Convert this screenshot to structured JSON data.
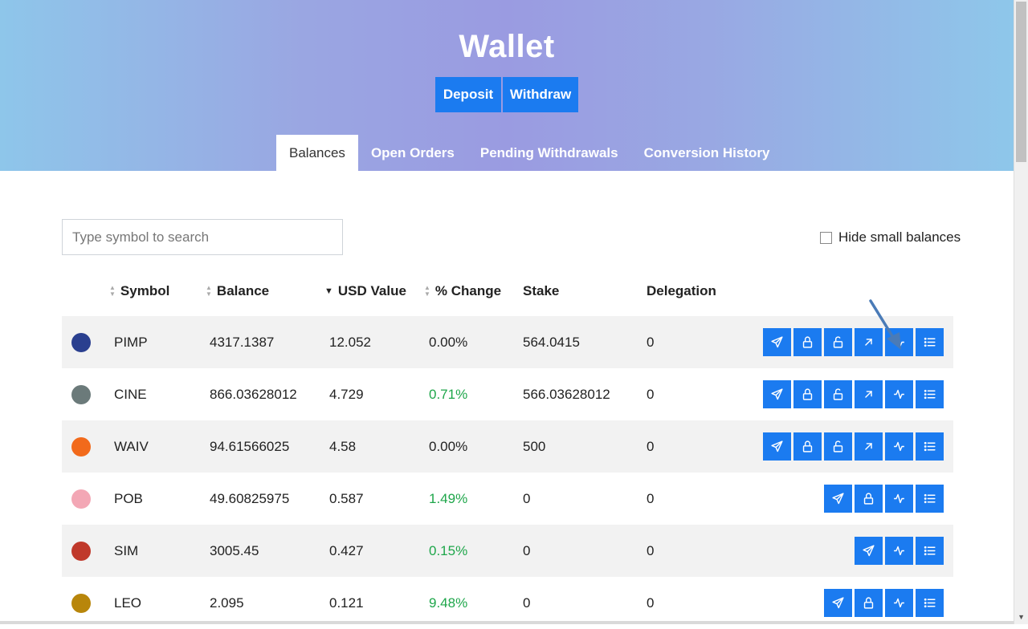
{
  "header": {
    "title": "Wallet",
    "deposit_label": "Deposit",
    "withdraw_label": "Withdraw"
  },
  "tabs": [
    {
      "label": "Balances",
      "active": true
    },
    {
      "label": "Open Orders",
      "active": false
    },
    {
      "label": "Pending Withdrawals",
      "active": false
    },
    {
      "label": "Conversion History",
      "active": false
    }
  ],
  "search": {
    "placeholder": "Type symbol to search",
    "value": ""
  },
  "hide_small": {
    "label": "Hide small balances",
    "checked": false
  },
  "columns": {
    "symbol": "Symbol",
    "balance": "Balance",
    "usd_value": "USD Value",
    "change": "% Change",
    "stake": "Stake",
    "delegation": "Delegation"
  },
  "rows": [
    {
      "symbol": "PIMP",
      "balance": "4317.1387",
      "usd": "12.052",
      "change": "0.00%",
      "change_positive": false,
      "stake": "564.0415",
      "delegation": "0",
      "logo_color": "#2a3f8f",
      "actions": [
        "send-icon",
        "stake-icon",
        "unstake-icon",
        "delegate-icon",
        "chart-icon",
        "history-icon"
      ]
    },
    {
      "symbol": "CINE",
      "balance": "866.03628012",
      "usd": "4.729",
      "change": "0.71%",
      "change_positive": true,
      "stake": "566.03628012",
      "delegation": "0",
      "logo_color": "#6b7a7a",
      "actions": [
        "send-icon",
        "stake-icon",
        "unstake-icon",
        "delegate-icon",
        "chart-icon",
        "history-icon"
      ]
    },
    {
      "symbol": "WAIV",
      "balance": "94.61566025",
      "usd": "4.58",
      "change": "0.00%",
      "change_positive": false,
      "stake": "500",
      "delegation": "0",
      "logo_color": "#f26a1b",
      "actions": [
        "send-icon",
        "stake-icon",
        "unstake-icon",
        "delegate-icon",
        "chart-icon",
        "history-icon"
      ]
    },
    {
      "symbol": "POB",
      "balance": "49.60825975",
      "usd": "0.587",
      "change": "1.49%",
      "change_positive": true,
      "stake": "0",
      "delegation": "0",
      "logo_color": "#f3a7b5",
      "actions": [
        "send-icon",
        "stake-icon",
        "chart-icon",
        "history-icon"
      ]
    },
    {
      "symbol": "SIM",
      "balance": "3005.45",
      "usd": "0.427",
      "change": "0.15%",
      "change_positive": true,
      "stake": "0",
      "delegation": "0",
      "logo_color": "#c0392b",
      "actions": [
        "send-icon",
        "chart-icon",
        "history-icon"
      ]
    },
    {
      "symbol": "LEO",
      "balance": "2.095",
      "usd": "0.121",
      "change": "9.48%",
      "change_positive": true,
      "stake": "0",
      "delegation": "0",
      "logo_color": "#b8860b",
      "actions": [
        "send-icon",
        "stake-icon",
        "chart-icon",
        "history-icon"
      ]
    }
  ],
  "colors": {
    "accent": "#1b7bf0",
    "positive": "#1ea64a",
    "annotation_arrow": "#4a7bb7"
  }
}
